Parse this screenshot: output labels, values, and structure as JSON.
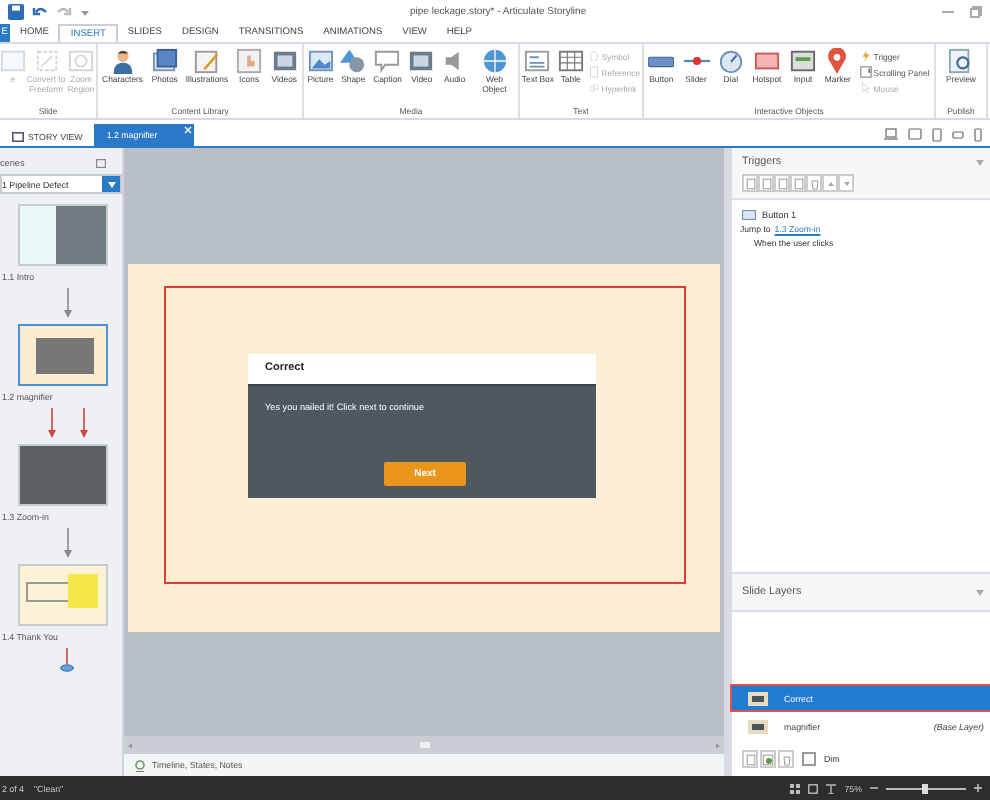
{
  "window": {
    "title": "pipe leckage.story* - Articulate Storyline"
  },
  "ribbon_tabs": [
    {
      "label": "E",
      "kind": "file",
      "selected": false
    },
    {
      "label": "HOME",
      "kind": "tab",
      "selected": false
    },
    {
      "label": "INSERT",
      "kind": "tab",
      "selected": true
    },
    {
      "label": "SLIDES",
      "kind": "tab",
      "selected": false
    },
    {
      "label": "DESIGN",
      "kind": "tab",
      "selected": false
    },
    {
      "label": "TRANSITIONS",
      "kind": "tab",
      "selected": false
    },
    {
      "label": "ANIMATIONS",
      "kind": "tab",
      "selected": false
    },
    {
      "label": "VIEW",
      "kind": "tab",
      "selected": false
    },
    {
      "label": "HELP",
      "kind": "tab",
      "selected": false
    }
  ],
  "ribbon_groups": [
    {
      "label": "Slide",
      "items": [
        {
          "label": "e",
          "kind": "large",
          "disabled": true
        },
        {
          "label": "Convert to Freeform",
          "kind": "large",
          "disabled": true
        },
        {
          "label": "Zoom Region",
          "kind": "large",
          "disabled": true
        }
      ]
    },
    {
      "label": "Content Library",
      "items": [
        {
          "label": "Characters",
          "kind": "large",
          "disabled": false
        },
        {
          "label": "Photos",
          "kind": "large",
          "disabled": false
        },
        {
          "label": "Illustrations",
          "kind": "large",
          "disabled": false
        },
        {
          "label": "Icons",
          "kind": "large",
          "disabled": false
        },
        {
          "label": "Videos",
          "kind": "large",
          "disabled": false
        }
      ]
    },
    {
      "label": "Media",
      "items": [
        {
          "label": "Picture",
          "kind": "large",
          "disabled": false
        },
        {
          "label": "Shape",
          "kind": "large",
          "disabled": false
        },
        {
          "label": "Caption",
          "kind": "large",
          "disabled": false
        },
        {
          "label": "Video",
          "kind": "large",
          "disabled": false
        },
        {
          "label": "Audio",
          "kind": "large",
          "disabled": false
        },
        {
          "label": "Web Object",
          "kind": "large",
          "disabled": false
        }
      ]
    },
    {
      "label": "Text",
      "items": [
        {
          "label": "Text Box",
          "kind": "large",
          "disabled": false
        },
        {
          "label": "Table",
          "kind": "large",
          "disabled": false
        },
        {
          "label": "Symbol",
          "kind": "small",
          "disabled": true
        },
        {
          "label": "Reference",
          "kind": "small",
          "disabled": true
        },
        {
          "label": "Hyperlink",
          "kind": "small",
          "disabled": true
        }
      ]
    },
    {
      "label": "Interactive Objects",
      "items": [
        {
          "label": "Button",
          "kind": "large",
          "disabled": false
        },
        {
          "label": "Slider",
          "kind": "large",
          "disabled": false
        },
        {
          "label": "Dial",
          "kind": "large",
          "disabled": false
        },
        {
          "label": "Hotspot",
          "kind": "large",
          "disabled": false
        },
        {
          "label": "Input",
          "kind": "large",
          "disabled": false
        },
        {
          "label": "Marker",
          "kind": "large",
          "disabled": false
        },
        {
          "label": "Trigger",
          "kind": "small",
          "disabled": false
        },
        {
          "label": "Scrolling Panel",
          "kind": "small",
          "disabled": false
        },
        {
          "label": "Mouse",
          "kind": "small",
          "disabled": true
        }
      ]
    },
    {
      "label": "Publish",
      "items": [
        {
          "label": "Preview",
          "kind": "large",
          "disabled": false
        }
      ]
    }
  ],
  "doc_tabs": [
    {
      "label": "STORY VIEW",
      "selected": false
    },
    {
      "label": "1.2 magnifier",
      "selected": true
    }
  ],
  "scenes": {
    "title": "cenes",
    "dropdown": "1 Pipeline Defect",
    "slides": [
      {
        "label": "1.1 Intro",
        "selected": false
      },
      {
        "label": "1.2 magnifier",
        "selected": true
      },
      {
        "label": "1.3 Zoom-in",
        "selected": false
      },
      {
        "label": "1.4 Thank You",
        "selected": false
      }
    ]
  },
  "slide": {
    "dialog_title": "Correct",
    "message": "Yes you nailed it! Click next to continue",
    "button": "Next"
  },
  "timeline_bar": "Timeline, States, Notes",
  "triggers": {
    "title": "Triggers",
    "object": "Button 1",
    "action": "Jump to",
    "target": "1.3 Zoom-in",
    "condition": "When the user clicks"
  },
  "slide_layers": {
    "title": "Slide Layers",
    "layers": [
      {
        "name": "Correct",
        "selected": true
      },
      {
        "name": "magnifier",
        "note": "(Base Layer)",
        "selected": false
      }
    ],
    "dim": {
      "label": "Dim",
      "checked": false
    }
  },
  "status_bar": {
    "slide": "2 of 4",
    "theme": "\"Clean\"",
    "zoom": "75%",
    "level": 0.5
  }
}
